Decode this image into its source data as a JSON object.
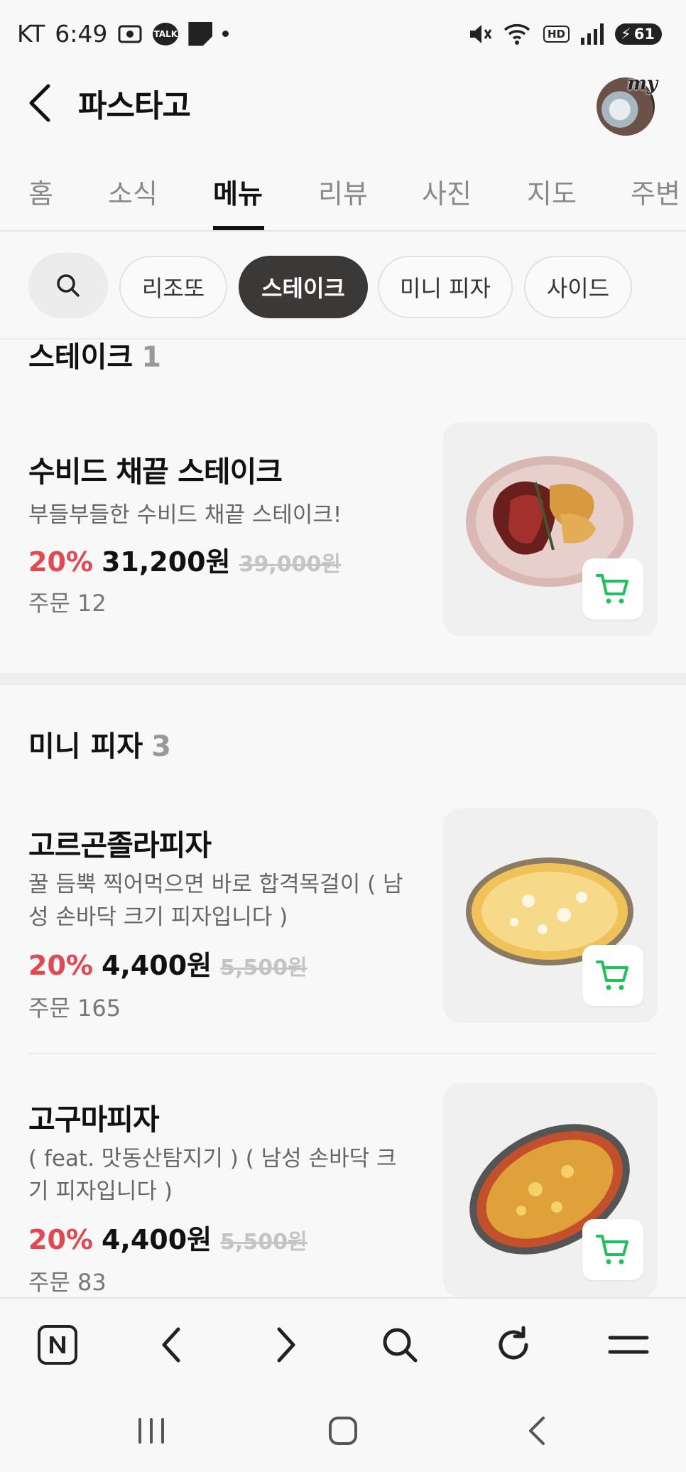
{
  "status_bar": {
    "carrier": "KT",
    "time": "6:49",
    "talk_label": "TALK",
    "hd_label": "HD",
    "battery": "61"
  },
  "header": {
    "title": "파스타고",
    "avatar_text": "my"
  },
  "tabs": [
    {
      "label": "홈"
    },
    {
      "label": "소식"
    },
    {
      "label": "메뉴",
      "active": true
    },
    {
      "label": "리뷰"
    },
    {
      "label": "사진"
    },
    {
      "label": "지도"
    },
    {
      "label": "주변"
    }
  ],
  "filters": [
    {
      "label": "리조또"
    },
    {
      "label": "스테이크",
      "active": true
    },
    {
      "label": "미니 피자"
    },
    {
      "label": "사이드"
    }
  ],
  "sections": [
    {
      "title": "스테이크",
      "count": "1",
      "items": [
        {
          "name": "수비드 채끝 스테이크",
          "desc": "부들부들한 수비드 채끝 스테이크!",
          "discount": "20%",
          "price": "31,200원",
          "original_price": "39,000원",
          "orders": "주문 12"
        }
      ]
    },
    {
      "title": "미니 피자",
      "count": "3",
      "items": [
        {
          "name": "고르곤졸라피자",
          "desc": "꿀 듬뿍 찍어먹으면 바로 합격목걸이 ( 남성 손바닥 크기 피자입니다 )",
          "discount": "20%",
          "price": "4,400원",
          "original_price": "5,500원",
          "orders": "주문 165"
        },
        {
          "name": "고구마피자",
          "desc": "( feat. 맛동산탐지기 ) ( 남성 손바닥 크기 피자입니다 )",
          "discount": "20%",
          "price": "4,400원",
          "original_price": "5,500원",
          "orders": "주문 83"
        }
      ]
    }
  ],
  "browser_bar": {
    "icons": [
      "naver-home-icon",
      "back-arrow-icon",
      "forward-arrow-icon",
      "search-icon",
      "refresh-icon",
      "menu-icon"
    ]
  },
  "colors": {
    "accent_discount": "#e3474f",
    "cart_green": "#1ec25a",
    "active_chip": "#3b3838"
  }
}
